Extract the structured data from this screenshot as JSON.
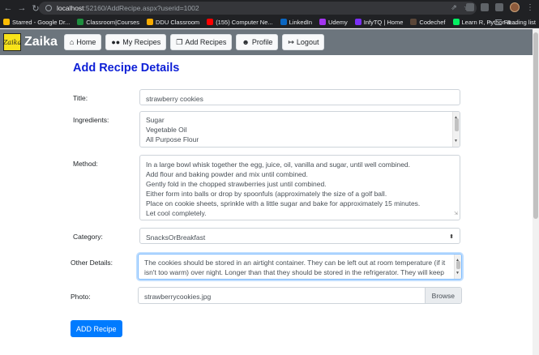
{
  "browser": {
    "url_host": "localhost",
    "url_path": ":52160/AddRecipe.aspx?userid=1002",
    "bookmarks": [
      {
        "label": "Starred - Google Dr...",
        "color": "#fbbc04"
      },
      {
        "label": "Classroom|Courses",
        "color": "#1e8e3e"
      },
      {
        "label": "DDU Classroom",
        "color": "#f9ab00"
      },
      {
        "label": "(155) Computer Ne...",
        "color": "#ff0000"
      },
      {
        "label": "LinkedIn",
        "color": "#0a66c2"
      },
      {
        "label": "Udemy",
        "color": "#a435f0"
      },
      {
        "label": "InfyTQ | Home",
        "color": "#7b2ff7"
      },
      {
        "label": "Codechef",
        "color": "#5b4638"
      },
      {
        "label": "Learn R, Python &...",
        "color": "#03ef62"
      }
    ],
    "more": "»",
    "reading_list": "Reading list"
  },
  "nav": {
    "brand": "Zaika",
    "logo_text": "Zaika",
    "items": [
      {
        "label": "Home",
        "icon": "home-icon"
      },
      {
        "label": "My Recipes",
        "icon": "users-icon"
      },
      {
        "label": "Add Recipes",
        "icon": "utensils-icon"
      },
      {
        "label": "Profile",
        "icon": "user-icon"
      },
      {
        "label": "Logout",
        "icon": "logout-icon"
      }
    ]
  },
  "form": {
    "heading": "Add Recipe Details",
    "title_label": "Title:",
    "title_value": "strawberry cookies",
    "ingredients_label": "Ingredients:",
    "ingredients_lines": [
      "Sugar",
      "Vegetable Oil",
      "All Purpose Flour"
    ],
    "method_label": "Method:",
    "method_lines": [
      "In a large bowl whisk together the egg, juice, oil, vanilla and sugar, until well combined.",
      "Add flour and baking powder and mix until combined.",
      "Gently fold in the chopped strawberries just until combined.",
      "Either form into balls or drop by spoonfuls (approximately the size of a golf ball.",
      "Place on cookie sheets, sprinkle with a little sugar and bake for approximately 15 minutes.",
      "Let cool completely."
    ],
    "category_label": "Category:",
    "category_value": "SnacksOrBreakfast",
    "other_label": "Other Details:",
    "other_lines": [
      "The cookies should be stored in an airtight container. They can be left out at room temperature (if it",
      "isn't too warm) over night. Longer than that they should be stored in the refrigerator. They will keep"
    ],
    "photo_label": "Photo:",
    "photo_value": "strawberrycookies.jpg",
    "browse_label": "Browse",
    "submit_label": "ADD Recipe"
  },
  "colors": {
    "navbar": "#6c757d",
    "heading": "#0d1fd6",
    "primary": "#007bff",
    "logo_bg": "#f7e31a"
  }
}
